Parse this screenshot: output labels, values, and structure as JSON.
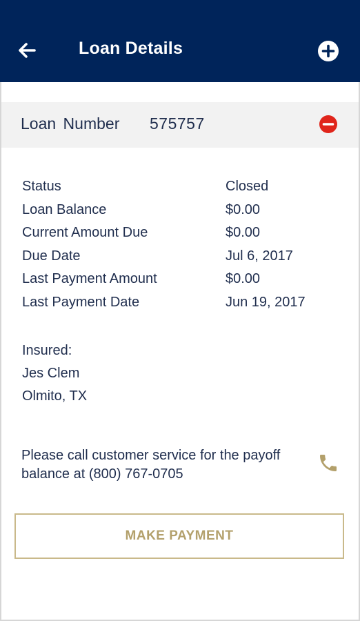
{
  "header": {
    "title": "Loan Details",
    "back_icon": "arrow-left-icon",
    "add_icon": "plus-circle-icon"
  },
  "loan": {
    "number_label": "Loan Number",
    "number_value": "575757",
    "remove_icon": "minus-circle-icon"
  },
  "details": [
    {
      "label": "Status",
      "value": "Closed"
    },
    {
      "label": "Loan Balance",
      "value": "$0.00"
    },
    {
      "label": "Current Amount Due",
      "value": "$0.00"
    },
    {
      "label": "Due Date",
      "value": "Jul 6, 2017"
    },
    {
      "label": "Last Payment Amount",
      "value": "$0.00"
    },
    {
      "label": "Last Payment Date",
      "value": "Jun 19, 2017"
    }
  ],
  "insured": {
    "label": "Insured:",
    "name": "Jes Clem",
    "location": "Olmito, TX"
  },
  "notice": {
    "text": "Please call customer service for the payoff balance at (800) 767-0705",
    "phone_icon": "phone-icon"
  },
  "actions": {
    "make_payment_label": "MAKE PAYMENT"
  },
  "colors": {
    "header_bg": "#00245a",
    "remove_red": "#e0251b",
    "accent_gold": "#b3a06b",
    "text_navy": "#1f2d4d"
  }
}
